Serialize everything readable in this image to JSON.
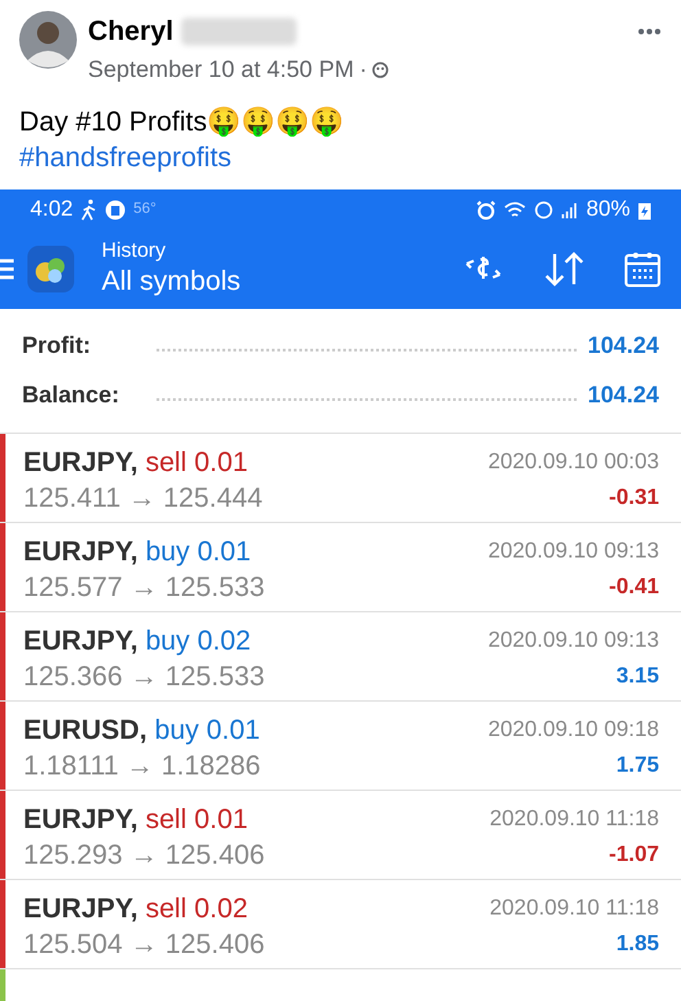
{
  "post": {
    "author": "Cheryl",
    "timestamp": "September 10 at 4:50 PM",
    "separator": "·",
    "text": "Day #10 Profits🤑🤑🤑🤑",
    "hashtag": "#handsfreeprofits"
  },
  "status_bar": {
    "time": "4:02",
    "temperature": "56°",
    "battery": "80%"
  },
  "app_bar": {
    "subtitle": "History",
    "title": "All symbols"
  },
  "summary": [
    {
      "label": "Profit:",
      "value": "104.24"
    },
    {
      "label": "Balance:",
      "value": "104.24"
    }
  ],
  "trades": [
    {
      "symbol": "EURJPY,",
      "side": "sell",
      "kind": "sell",
      "volume": "0.01",
      "prices": "125.411 → 125.444",
      "time": "2020.09.10 00:03",
      "profit": "-0.31",
      "loss": true,
      "color": "#d32f2f"
    },
    {
      "symbol": "EURJPY,",
      "side": "buy",
      "kind": "buy",
      "volume": "0.01",
      "prices": "125.577 → 125.533",
      "time": "2020.09.10 09:13",
      "profit": "-0.41",
      "loss": true,
      "color": "#d32f2f"
    },
    {
      "symbol": "EURJPY,",
      "side": "buy",
      "kind": "buy",
      "volume": "0.02",
      "prices": "125.366 → 125.533",
      "time": "2020.09.10 09:13",
      "profit": "3.15",
      "loss": false,
      "color": "#d32f2f"
    },
    {
      "symbol": "EURUSD,",
      "side": "buy",
      "kind": "buy",
      "volume": "0.01",
      "prices": "1.18111 → 1.18286",
      "time": "2020.09.10 09:18",
      "profit": "1.75",
      "loss": false,
      "color": "#d32f2f"
    },
    {
      "symbol": "EURJPY,",
      "side": "sell",
      "kind": "sell",
      "volume": "0.01",
      "prices": "125.293 → 125.406",
      "time": "2020.09.10 11:18",
      "profit": "-1.07",
      "loss": true,
      "color": "#d32f2f"
    },
    {
      "symbol": "EURJPY,",
      "side": "sell",
      "kind": "sell",
      "volume": "0.02",
      "prices": "125.504 → 125.406",
      "time": "2020.09.10 11:18",
      "profit": "1.85",
      "loss": false,
      "color": "#d32f2f"
    },
    {
      "color": "#8bc34a"
    }
  ]
}
